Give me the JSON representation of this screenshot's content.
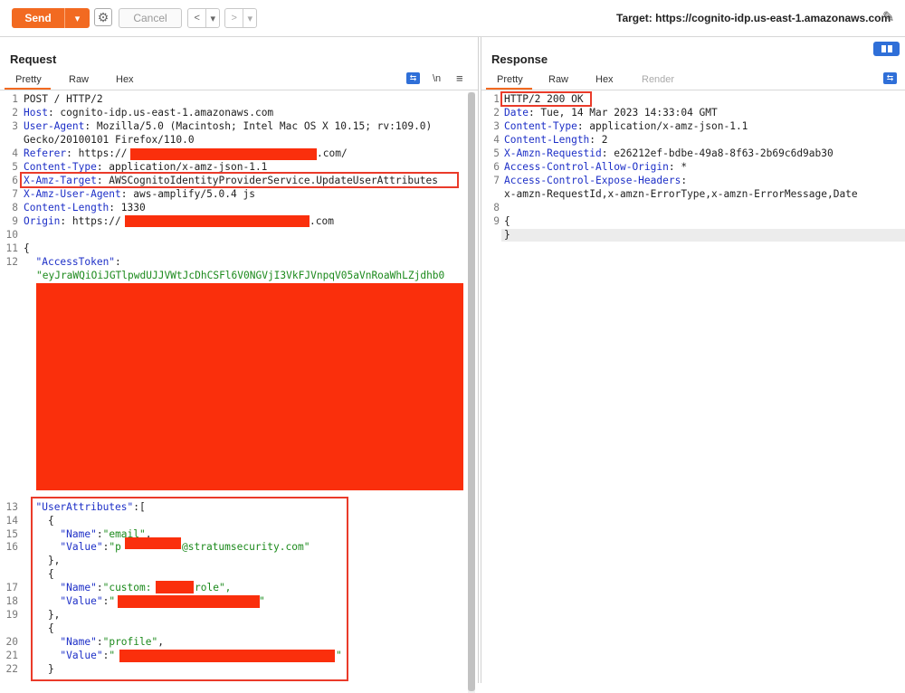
{
  "toolbar": {
    "send_label": "Send",
    "send_dropdown": "▾",
    "cancel_label": "Cancel",
    "back_glyph": "<",
    "back_dd": "▾",
    "fwd_glyph": ">",
    "fwd_dd": "▾",
    "target_text": "Target: https://cognito-idp.us-east-1.amazonaws.com"
  },
  "request": {
    "title": "Request",
    "tabs": [
      "Pretty",
      "Raw",
      "Hex"
    ],
    "tab_newline": "\\n",
    "tab_menu": "≡",
    "lines": [
      {
        "n": "1",
        "k": "",
        "v": "POST / HTTP/2"
      },
      {
        "n": "2",
        "k": "Host",
        "v": ": cognito-idp.us-east-1.amazonaws.com"
      },
      {
        "n": "3",
        "k": "User-Agent",
        "v": ": Mozilla/5.0 (Macintosh; Intel Mac OS X 10.15; rv:109.0)"
      },
      {
        "n": "",
        "k": "",
        "v": "Gecko/20100101 Firefox/110.0"
      },
      {
        "n": "4",
        "k": "Referer",
        "v": ": https://"
      },
      {
        "n": "5",
        "k": "Content-Type",
        "v": ": application/x-amz-json-1.1"
      },
      {
        "n": "6",
        "k": "X-Amz-Target",
        "v": ": AWSCognitoIdentityProviderService.UpdateUserAttributes"
      },
      {
        "n": "7",
        "k": "X-Amz-User-Agent",
        "v": ": aws-amplify/5.0.4 js"
      },
      {
        "n": "8",
        "k": "Content-Length",
        "v": ": 1330"
      },
      {
        "n": "9",
        "k": "Origin",
        "v": ": https://"
      },
      {
        "n": "10",
        "k": "",
        "v": ""
      },
      {
        "n": "11",
        "k": "",
        "v": "{"
      },
      {
        "n": "12",
        "k": "",
        "v": "  \"AccessToken\":"
      }
    ],
    "referer_suffix": ".com/",
    "origin_suffix": ".com",
    "token_text": "\"eyJraWQiOiJGTlpwdUJJVWtJcDhCSFl6V0NGVjI3VkFJVnpqV05aVnRoaWhLZjdhb0",
    "lines2": [
      {
        "n": "13",
        "t": "  \"UserAttributes\":["
      },
      {
        "n": "14",
        "t": "    {"
      },
      {
        "n": "15",
        "t": "      \"Name\":\"email\","
      },
      {
        "n": "16",
        "t": "      \"Value\":\"p"
      },
      {
        "n": "",
        "t": "    },"
      },
      {
        "n": "",
        "t": "    {"
      },
      {
        "n": "17",
        "t": "      \"Name\":\"custom:"
      },
      {
        "n": "18",
        "t": "      \"Value\":\""
      },
      {
        "n": "19",
        "t": "    },"
      },
      {
        "n": "",
        "t": "    {"
      },
      {
        "n": "20",
        "t": "      \"Name\":\"profile\","
      },
      {
        "n": "21",
        "t": "      \"Value\":\""
      },
      {
        "n": "22",
        "t": "    }"
      }
    ],
    "email_suffix": "@stratumsecurity.com\"",
    "role_suffix": "role\",",
    "quote_end": "\""
  },
  "response": {
    "title": "Response",
    "tabs": [
      "Pretty",
      "Raw",
      "Hex",
      "Render"
    ],
    "lines": [
      {
        "n": "1",
        "k": "HTTP/2 200 OK",
        "v": ""
      },
      {
        "n": "2",
        "k": "Date",
        "v": ": Tue, 14 Mar 2023 14:33:04 GMT"
      },
      {
        "n": "3",
        "k": "Content-Type",
        "v": ": application/x-amz-json-1.1"
      },
      {
        "n": "4",
        "k": "Content-Length",
        "v": ": 2"
      },
      {
        "n": "5",
        "k": "X-Amzn-Requestid",
        "v": ": e26212ef-bdbe-49a8-8f63-2b69c6d9ab30"
      },
      {
        "n": "6",
        "k": "Access-Control-Allow-Origin",
        "v": ": *"
      },
      {
        "n": "7",
        "k": "Access-Control-Expose-Headers",
        "v": ":"
      },
      {
        "n": "",
        "k": "",
        "v": "x-amzn-RequestId,x-amzn-ErrorType,x-amzn-ErrorMessage,Date"
      },
      {
        "n": "8",
        "k": "",
        "v": ""
      },
      {
        "n": "9",
        "k": "",
        "v": "{"
      },
      {
        "n": "",
        "k": "",
        "v": "}"
      }
    ]
  },
  "colors": {
    "accent": "#f26a21",
    "redaction": "#fa2f0c",
    "header_key": "#1d2fc7",
    "string": "#1c8a1c",
    "highlight_box": "#ea3b2a"
  }
}
